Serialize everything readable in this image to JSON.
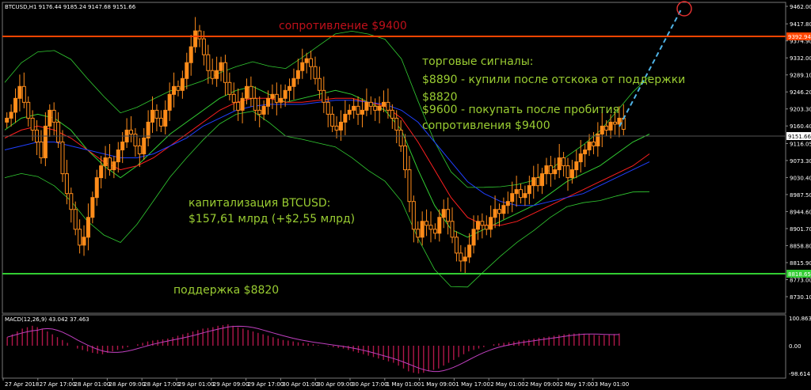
{
  "header": {
    "title": "BTCUSD,H1  9176.44 9185.24 9147.68 9151.66"
  },
  "colors": {
    "background": "#000000",
    "bull": "#ff8c1a",
    "bear": "#ff8c1a",
    "resistance": "#ff4500",
    "support": "#32cd32",
    "annotation_red": "#c0101a",
    "annotation_green": "#9acd32",
    "bollinger": "#32cd32",
    "ma_fast": "#32cd32",
    "ma_mid": "#ff2020",
    "ma_slow": "#2040ff",
    "forecast": "#4fb3e6",
    "macd_hist": "#b0184a",
    "macd_signal": "#c040c0",
    "grid": "#404040"
  },
  "annotations": {
    "resistance": "сопротивление $9400",
    "signals": [
      "торговые сигналы:",
      "$8890 - купили после отскока от поддержки",
      "$8820",
      "$9600 - покупать после пробития",
      "сопротивления $9400"
    ],
    "cap": [
      "капитализация BTCUSD:",
      "$157,61 млрд (+$2,55 млрд)"
    ],
    "support": "поддержка $8820"
  },
  "price_tags": {
    "resistance": "9392.94",
    "last": "9151.66",
    "support": "8818.65"
  },
  "macd": {
    "title": "MACD(12,26,9) 43.042 37.463",
    "ticks": [
      "100.863",
      "0.00",
      "-98.614"
    ]
  },
  "chart_data": {
    "type": "candlestick",
    "title": "BTCUSD,H1",
    "ohlc_header": {
      "open": 9176.44,
      "high": 9185.24,
      "low": 9147.68,
      "close": 9151.66
    },
    "y_ticks": [
      "9462.00",
      "9417.80",
      "9374.90",
      "9332.00",
      "9289.10",
      "9246.20",
      "9203.30",
      "9160.40",
      "9116.05",
      "9073.30",
      "9030.40",
      "8987.50",
      "8944.60",
      "8901.70",
      "8858.80",
      "8815.90",
      "8773.00",
      "8730.10"
    ],
    "ylim": [
      8730.1,
      9462.0
    ],
    "x_labels": [
      "27 Apr 2018",
      "27 Apr 17:00",
      "28 Apr 01:00",
      "28 Apr 09:00",
      "28 Apr 17:00",
      "29 Apr 01:00",
      "29 Apr 09:00",
      "29 Apr 17:00",
      "30 Apr 01:00",
      "30 Apr 09:00",
      "30 Apr 17:00",
      "1 May 01:00",
      "1 May 09:00",
      "1 May 17:00",
      "2 May 01:00",
      "2 May 09:00",
      "2 May 17:00",
      "3 May 01:00"
    ],
    "levels": {
      "resistance": 9392.94,
      "support": 8818.65
    },
    "close_series": [
      9180,
      9195,
      9230,
      9260,
      9220,
      9180,
      9150,
      9120,
      9080,
      9160,
      9200,
      9170,
      9120,
      9040,
      8990,
      8950,
      8900,
      8860,
      8880,
      8930,
      8980,
      9030,
      9060,
      9080,
      9050,
      9070,
      9100,
      9120,
      9150,
      9140,
      9110,
      9090,
      9130,
      9170,
      9200,
      9180,
      9160,
      9200,
      9240,
      9260,
      9250,
      9280,
      9320,
      9360,
      9400,
      9380,
      9340,
      9300,
      9280,
      9300,
      9320,
      9270,
      9240,
      9220,
      9200,
      9230,
      9260,
      9230,
      9200,
      9190,
      9210,
      9230,
      9240,
      9220,
      9230,
      9250,
      9260,
      9280,
      9300,
      9320,
      9330,
      9310,
      9280,
      9250,
      9220,
      9190,
      9160,
      9150,
      9170,
      9190,
      9200,
      9210,
      9190,
      9200,
      9220,
      9210,
      9200,
      9210,
      9220,
      9200,
      9180,
      9150,
      9110,
      9050,
      8970,
      8900,
      8880,
      8920,
      8910,
      8900,
      8890,
      8930,
      8950,
      8920,
      8880,
      8840,
      8820,
      8830,
      8860,
      8900,
      8920,
      8910,
      8900,
      8930,
      8950,
      8940,
      8960,
      8970,
      8990,
      9000,
      8980,
      8990,
      9010,
      9030,
      9010,
      9040,
      9060,
      9040,
      9050,
      9080,
      9060,
      9030,
      9050,
      9070,
      9090,
      9100,
      9120,
      9110,
      9140,
      9160,
      9150,
      9170,
      9165,
      9180,
      9152
    ],
    "macd_values": [
      30,
      40,
      50,
      60,
      65,
      70,
      65,
      60,
      50,
      40,
      30,
      20,
      10,
      0,
      -10,
      -15,
      -20,
      -25,
      -28,
      -30,
      -25,
      -20,
      -15,
      -10,
      -5,
      0,
      5,
      10,
      15,
      18,
      20,
      22,
      25,
      30,
      35,
      40,
      45,
      50,
      55,
      60,
      62,
      65,
      70,
      72,
      75,
      70,
      65,
      60,
      55,
      50,
      45,
      40,
      35,
      30,
      25,
      20,
      18,
      15,
      12,
      10,
      8,
      5,
      2,
      0,
      -2,
      -5,
      -8,
      -10,
      -15,
      -20,
      -25,
      -30,
      -35,
      -40,
      -45,
      -50,
      -55,
      -60,
      -70,
      -80,
      -90,
      -95,
      -98,
      -95,
      -90,
      -85,
      -80,
      -70,
      -60,
      -50,
      -40,
      -30,
      -20,
      -15,
      -10,
      -5,
      0,
      5,
      8,
      10,
      12,
      15,
      18,
      20,
      22,
      25,
      28,
      30,
      32,
      35,
      38,
      40,
      42,
      43,
      43,
      42,
      40,
      38,
      36,
      37,
      39,
      41,
      43
    ],
    "ma_series": [
      {
        "name": "",
        "color": "#32cd32",
        "values": [
          9150,
          9180,
          9190,
          9180,
          9150,
          9100,
          9060,
          9030,
          9060,
          9100,
          9140,
          9170,
          9200,
          9230,
          9250,
          9260,
          9240,
          9220,
          9230,
          9240,
          9250,
          9240,
          9220,
          9200,
          9150,
          9050,
          8960,
          8900,
          8880,
          8900,
          8920,
          8940,
          8960,
          8990,
          9020,
          9040,
          9060,
          9090,
          9120,
          9140
        ]
      },
      {
        "name": "",
        "color": "#ff2020",
        "values": [
          9130,
          9150,
          9160,
          9150,
          9130,
          9100,
          9070,
          9050,
          9060,
          9080,
          9110,
          9140,
          9170,
          9200,
          9220,
          9230,
          9230,
          9220,
          9220,
          9225,
          9230,
          9230,
          9220,
          9210,
          9180,
          9120,
          9050,
          8980,
          8930,
          8910,
          8910,
          8920,
          8940,
          8960,
          8980,
          9000,
          9020,
          9040,
          9060,
          9090
        ]
      },
      {
        "name": "",
        "color": "#2040ff",
        "values": [
          9100,
          9110,
          9120,
          9120,
          9110,
          9100,
          9090,
          9080,
          9080,
          9090,
          9110,
          9130,
          9160,
          9180,
          9200,
          9210,
          9215,
          9215,
          9215,
          9220,
          9225,
          9225,
          9220,
          9215,
          9200,
          9170,
          9120,
          9070,
          9020,
          8990,
          8970,
          8960,
          8960,
          8970,
          8980,
          8990,
          9010,
          9030,
          9050,
          9070
        ]
      }
    ]
  }
}
